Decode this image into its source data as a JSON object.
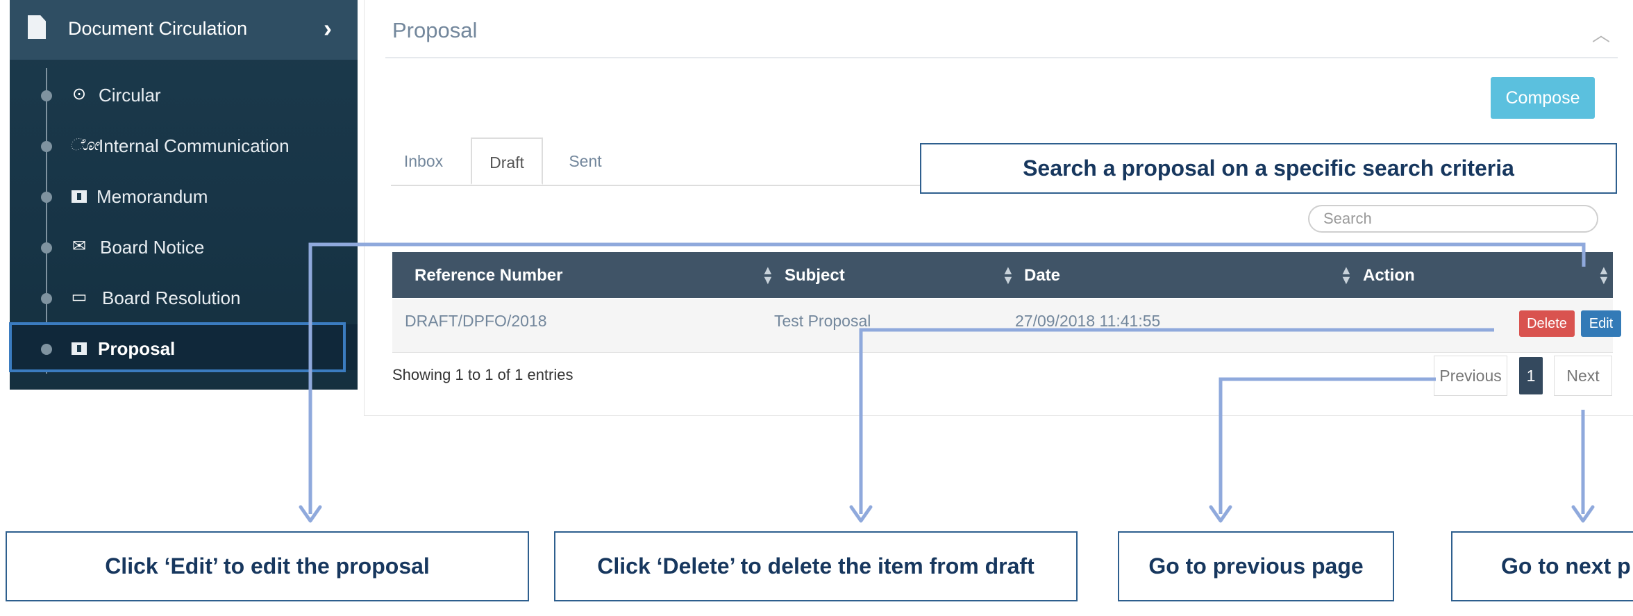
{
  "sidebar": {
    "header": {
      "title": "Document Circulation"
    },
    "items": [
      {
        "label": "Circular",
        "icon": "circle-dot-icon"
      },
      {
        "label": "Internal Communication",
        "icon": "ear-icon"
      },
      {
        "label": "Memorandum",
        "icon": "pause-box-icon"
      },
      {
        "label": "Board Notice",
        "icon": "envelope-icon"
      },
      {
        "label": "Board Resolution",
        "icon": "monitor-icon"
      },
      {
        "label": "Proposal",
        "icon": "pause-box-icon",
        "active": true
      }
    ]
  },
  "panel": {
    "title": "Proposal",
    "compose_label": "Compose",
    "tabs": [
      {
        "label": "Inbox"
      },
      {
        "label": "Draft",
        "active": true
      },
      {
        "label": "Sent"
      }
    ],
    "search": {
      "placeholder": "Search",
      "value": ""
    },
    "table": {
      "columns": [
        "Reference Number",
        "Subject",
        "Date",
        "Action"
      ],
      "rows": [
        {
          "ref": "DRAFT/DPFO/2018",
          "subject": "Test Proposal",
          "date": "27/09/2018 11:41:55",
          "delete_label": "Delete",
          "edit_label": "Edit"
        }
      ]
    },
    "footer": {
      "entries_text": "Showing 1 to 1 of 1 entries",
      "prev_label": "Previous",
      "page": "1",
      "next_label": "Next"
    }
  },
  "annotations": {
    "search": "Search a proposal on a specific search criteria",
    "edit": "Click  ‘Edit’ to edit the proposal",
    "delete": "Click  ‘Delete’ to delete the item from draft",
    "previous": "Go to previous  page",
    "next": "Go to next p"
  },
  "colors": {
    "sidebar_bg": "#1c3a4c",
    "header_bg": "#405467",
    "compose": "#5bc0de",
    "delete": "#d9534f",
    "edit": "#337ab7",
    "callout_border": "#2e5f8e",
    "arrow": "#8fa9dc"
  }
}
